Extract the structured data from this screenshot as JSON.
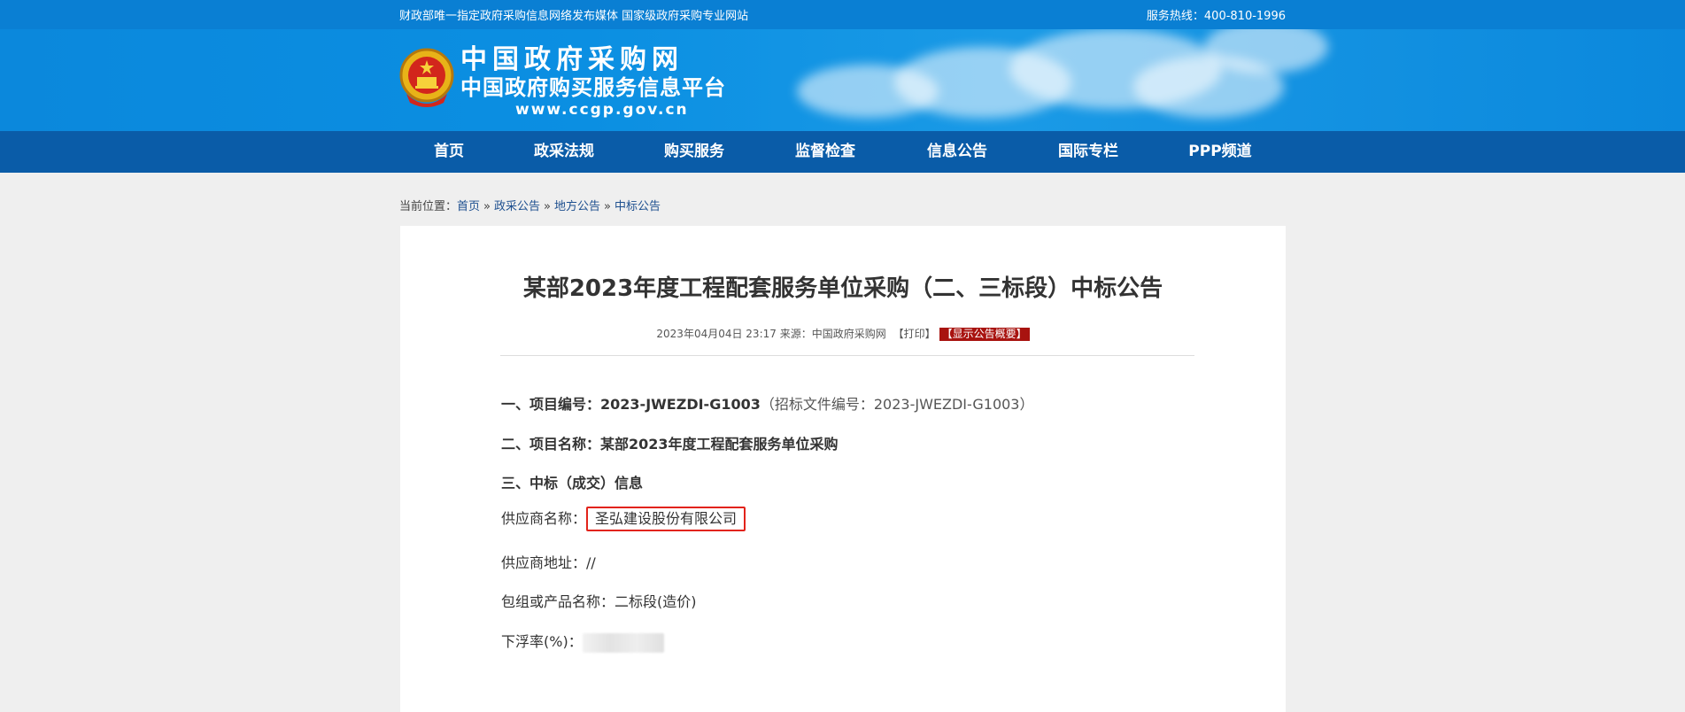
{
  "topbar": {
    "slogan": "财政部唯一指定政府采购信息网络发布媒体 国家级政府采购专业网站",
    "hotline": "服务热线：400-810-1996"
  },
  "header": {
    "logo_line1": "中国政府采购网",
    "logo_line2": "中国政府购买服务信息平台",
    "logo_url": "www.ccgp.gov.cn"
  },
  "nav": {
    "items": [
      {
        "label": "首页"
      },
      {
        "label": "政采法规"
      },
      {
        "label": "购买服务"
      },
      {
        "label": "监督检查"
      },
      {
        "label": "信息公告"
      },
      {
        "label": "国际专栏"
      },
      {
        "label": "PPP频道"
      }
    ]
  },
  "breadcrumb": {
    "prefix": "当前位置：",
    "items": [
      "首页",
      "政采公告",
      "地方公告",
      "中标公告"
    ],
    "separator": "»"
  },
  "article": {
    "title": "某部2023年度工程配套服务单位采购（二、三标段）中标公告",
    "meta_datetime": "2023年04月04日 23:17",
    "meta_source": "来源：中国政府采购网",
    "print_label": "【打印】",
    "summary_label": "【显示公告概要】",
    "project_no_label": "一、项目编号：",
    "project_no": "2023-JWEZDI-G1003",
    "bid_doc_no": "（招标文件编号：2023-JWEZDI-G1003）",
    "project_name_label": "二、项目名称：",
    "project_name": "某部2023年度工程配套服务单位采购",
    "award_heading": "三、中标（成交）信息",
    "supplier_name_label": "供应商名称：",
    "supplier_name": "圣弘建设股份有限公司",
    "supplier_addr_label": "供应商地址：",
    "supplier_addr": "//",
    "package_label": "包组或产品名称：",
    "package_name": "二标段(造价)",
    "discount_label": "下浮率(%)："
  },
  "colors": {
    "topstrip": "#0a7fd3",
    "banner": "#0b88dc",
    "nav": "#0a5ca8",
    "highlight_border": "#e2231a",
    "summary_badge": "#a8130f"
  }
}
